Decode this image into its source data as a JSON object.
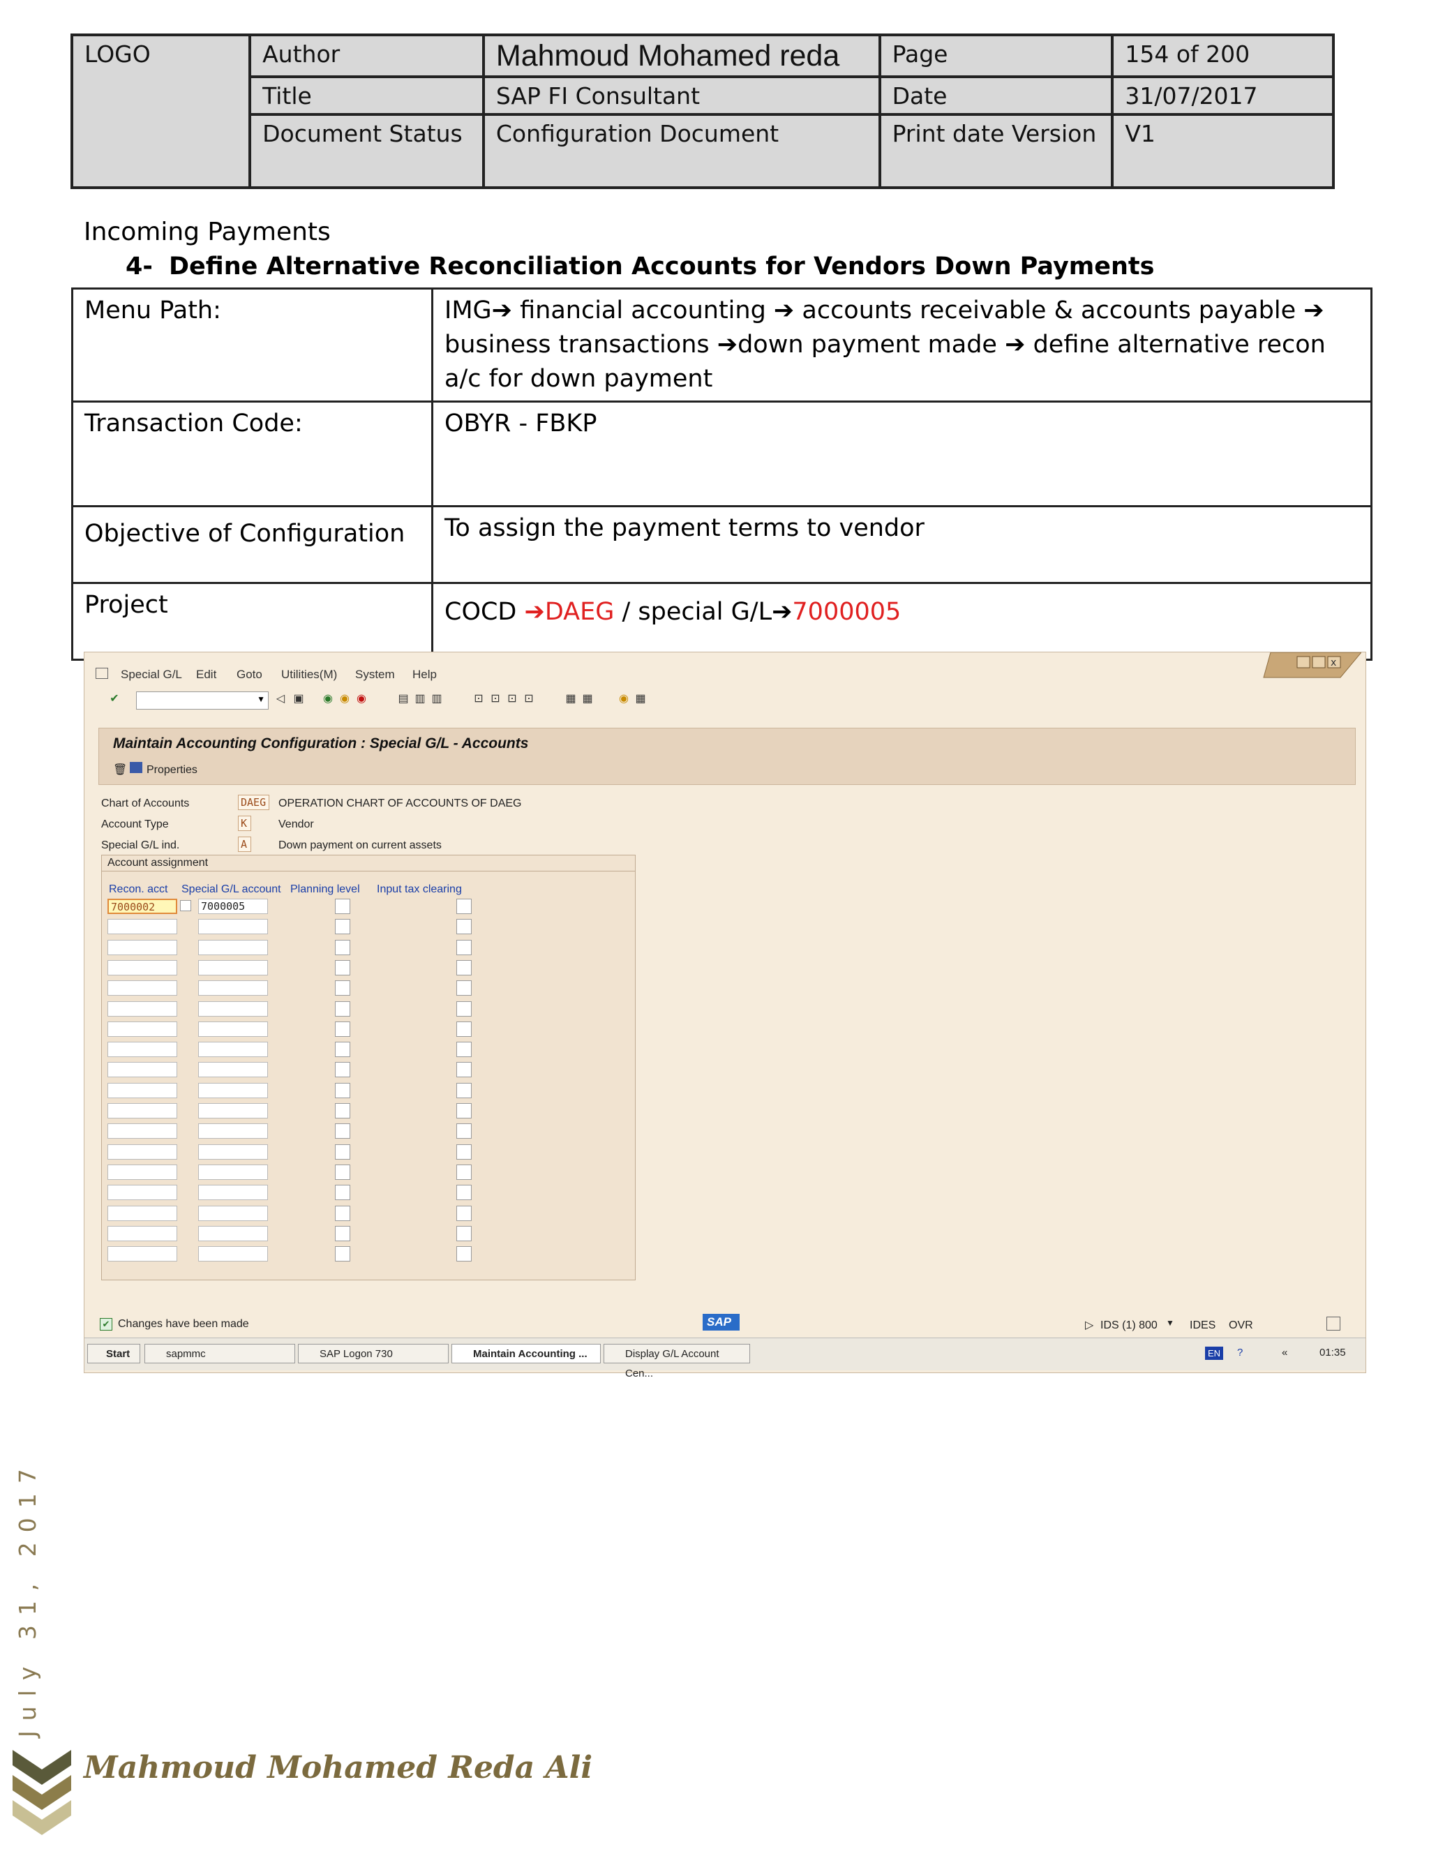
{
  "header": {
    "logo": "LOGO",
    "author_label": "Author",
    "author_value": "Mahmoud Mohamed reda",
    "page_label": "Page",
    "page_value": "154 of 200",
    "title_label": "Title",
    "title_value": "SAP FI Consultant",
    "date_label": "Date",
    "date_value": "31/07/2017",
    "status_label": "Document Status",
    "status_value": "Configuration Document",
    "print_label": "Print date Version",
    "print_value": "V1"
  },
  "section": {
    "heading": "Incoming Payments",
    "number": "4-",
    "title": "Define Alternative Reconciliation Accounts for Vendors Down Payments"
  },
  "info": {
    "menu_path_label": "Menu Path:",
    "menu_path_1": "IMG",
    "menu_path_2": " financial accounting ",
    "menu_path_3": " accounts receivable & accounts payable ",
    "menu_path_4": " business transactions ",
    "menu_path_5": "down payment made ",
    "menu_path_6": " define alternative recon a/c for down payment",
    "tcode_label": "Transaction Code:",
    "tcode_value": "OBYR - FBKP",
    "objective_label": "Objective of Configuration",
    "objective_value": "To assign the payment terms to vendor",
    "project_label": "Project",
    "project_prefix": "COCD ",
    "project_cocd": "DAEG",
    "project_mid": " / special G/L",
    "project_gl": "7000005",
    "arrow": "➔"
  },
  "sap": {
    "menu": [
      "Special G/L",
      "Edit",
      "Goto",
      "Utilities(M)",
      "System",
      "Help"
    ],
    "screen_title": "Maintain Accounting Configuration : Special G/L - Accounts",
    "properties": "Properties",
    "chart_label": "Chart of Accounts",
    "chart_value": "DAEG",
    "chart_desc": "OPERATION CHART OF ACCOUNTS OF DAEG",
    "acct_type_label": "Account Type",
    "acct_type_value": "K",
    "acct_type_desc": "Vendor",
    "sgl_label": "Special G/L ind.",
    "sgl_value": "A",
    "sgl_desc": "Down payment on current assets",
    "group_title": "Account assignment",
    "columns": [
      "Recon. acct",
      "Special G/L account",
      "Planning level",
      "Input tax clearing"
    ],
    "row1_recon": "7000002",
    "row1_special": "7000005",
    "status_message": "Changes have been made",
    "sap_logo": "SAP",
    "system_info": "IDS (1) 800",
    "client": "IDES",
    "mode": "OVR",
    "taskbar": [
      "Start",
      "sapmmc",
      "SAP Logon 730",
      "Maintain Accounting ...",
      "Display G/L Account Cen..."
    ],
    "lang": "EN",
    "clock": "01:35"
  },
  "footer": {
    "date": "July 31, 2017",
    "name": "Mahmoud Mohamed Reda Ali"
  }
}
